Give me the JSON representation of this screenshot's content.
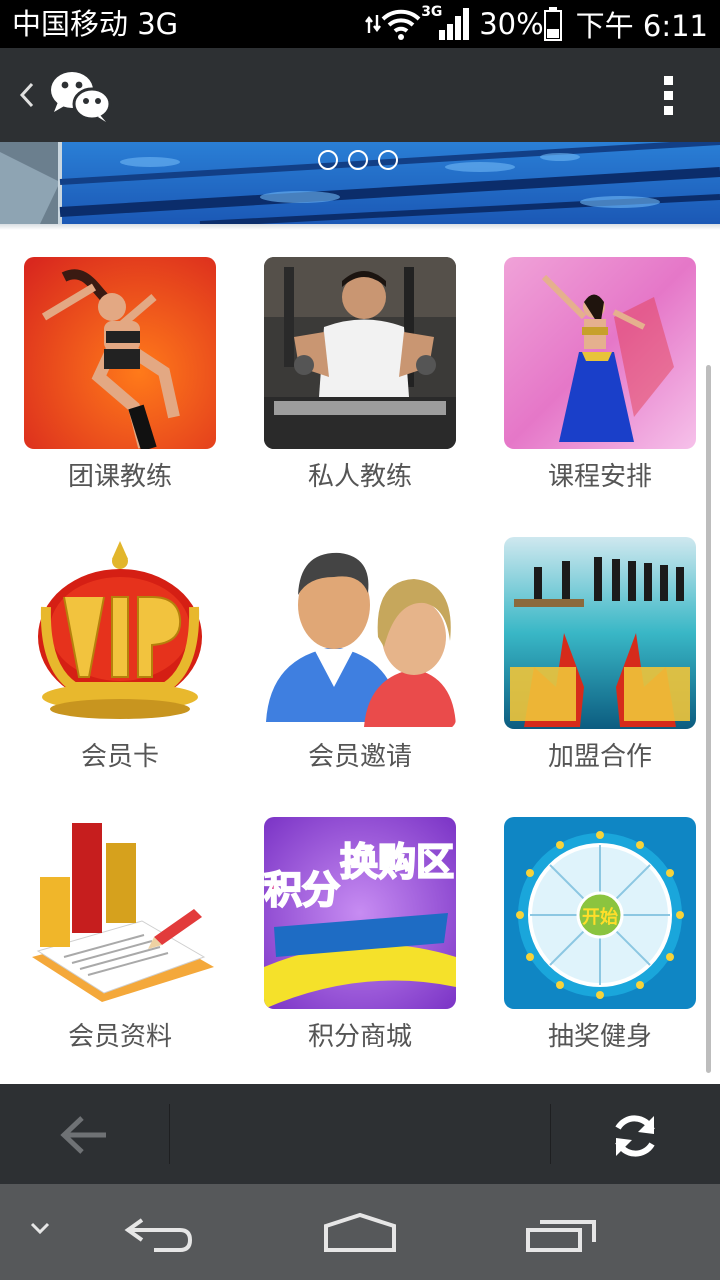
{
  "status_bar": {
    "carrier": "中国移动 3G",
    "network_badge": "3G",
    "battery": "30%",
    "time": "下午 6:11"
  },
  "title_bar": {
    "back_icon": "chevron-left-icon",
    "logo_icon": "wechat-icon",
    "menu_icon": "more-vertical-icon"
  },
  "banner": {
    "page_count": 3,
    "current_page": 0
  },
  "grid": {
    "items": [
      {
        "label": "团课教练",
        "icon": "dancer-photo"
      },
      {
        "label": "私人教练",
        "icon": "weightlifter-photo"
      },
      {
        "label": "课程安排",
        "icon": "belly-dancer-photo"
      },
      {
        "label": "会员卡",
        "icon": "vip-crown"
      },
      {
        "label": "会员邀请",
        "icon": "people-icon"
      },
      {
        "label": "加盟合作",
        "icon": "handshake-win-photo"
      },
      {
        "label": "会员资料",
        "icon": "notebook-chart"
      },
      {
        "label": "积分商城",
        "icon": "points-exchange-banner"
      },
      {
        "label": "抽奖健身",
        "icon": "lottery-wheel"
      }
    ],
    "tile_text": {
      "points_line1": "积分",
      "points_line2": "换购区",
      "lottery_center": "开始"
    }
  },
  "web_toolbar": {
    "back_icon": "arrow-left-icon",
    "refresh_icon": "refresh-icon"
  },
  "nav_bar": {
    "buttons": [
      "chevron-down-icon",
      "back-icon",
      "home-icon",
      "recent-apps-icon"
    ]
  },
  "colors": {
    "status_bar": "#000000",
    "title_bar": "#2d3033",
    "nav_bar": "#56585a",
    "label_text": "#555555"
  }
}
